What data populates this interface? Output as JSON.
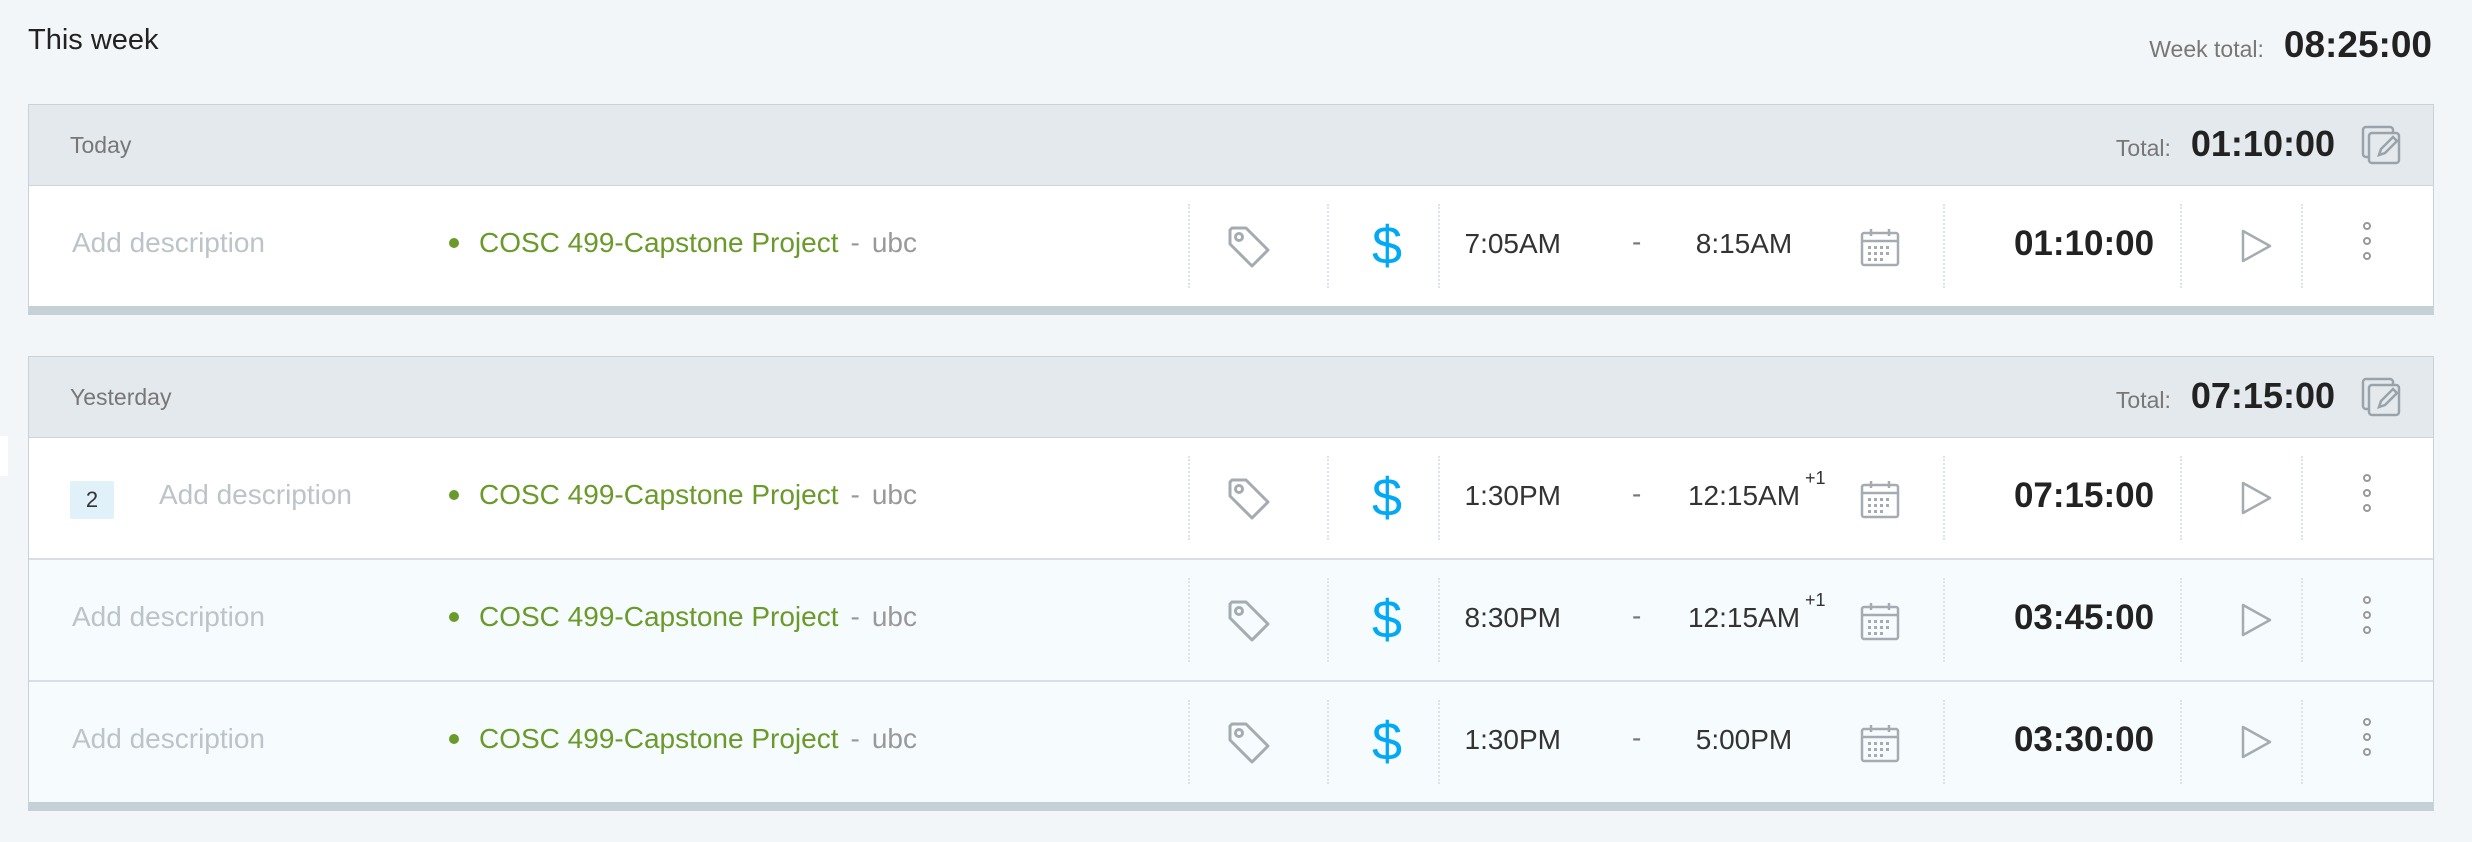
{
  "week": {
    "title": "This week",
    "total_label": "Week total:",
    "total": "08:25:00"
  },
  "groups": [
    {
      "title": "Today",
      "total_label": "Total:",
      "total": "01:10:00",
      "entries": [
        {
          "description_placeholder": "Add description",
          "project": "COSC 499-Capstone Project",
          "separator": "-",
          "client": "ubc",
          "start": "7:05AM",
          "end": "8:15AM",
          "end_day_offset": "",
          "duration": "01:10:00"
        }
      ]
    },
    {
      "title": "Yesterday",
      "total_label": "Total:",
      "total": "07:15:00",
      "entries": [
        {
          "group_count": "2",
          "description_placeholder": "Add description",
          "project": "COSC 499-Capstone Project",
          "separator": "-",
          "client": "ubc",
          "start": "1:30PM",
          "end": "12:15AM",
          "end_day_offset": "+1",
          "duration": "07:15:00"
        },
        {
          "description_placeholder": "Add description",
          "project": "COSC 499-Capstone Project",
          "separator": "-",
          "client": "ubc",
          "start": "8:30PM",
          "end": "12:15AM",
          "end_day_offset": "+1",
          "duration": "03:45:00"
        },
        {
          "description_placeholder": "Add description",
          "project": "COSC 499-Capstone Project",
          "separator": "-",
          "client": "ubc",
          "start": "1:30PM",
          "end": "5:00PM",
          "end_day_offset": "",
          "duration": "03:30:00"
        }
      ]
    }
  ],
  "time_separator": "-",
  "colors": {
    "project": "#6a9a2a",
    "billable": "#03a9f4",
    "group_header_bg": "#e4e9ed",
    "page_bg": "#f2f6f8"
  },
  "icons": {
    "tag": "tag-icon",
    "billable": "dollar-icon",
    "billable_glyph": "$",
    "calendar": "calendar-icon",
    "play": "play-icon",
    "more": "more-vertical-icon",
    "bulk_edit": "bulk-edit-icon"
  }
}
